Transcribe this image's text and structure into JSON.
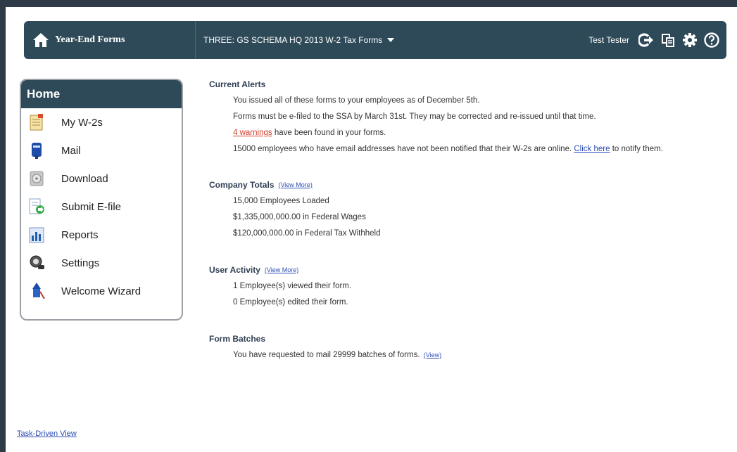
{
  "header": {
    "brand_title": "Year-End Forms",
    "schema_selector": "THREE: GS SCHEMA HQ 2013 W-2 Tax Forms",
    "user_name": "Test Tester",
    "colors": {
      "bar": "#2e4a58",
      "text": "#ffffff"
    },
    "icons": [
      "home-icon",
      "logout-icon",
      "copy-icon",
      "gear-icon",
      "help-icon"
    ]
  },
  "sidebar": {
    "title": "Home",
    "items": [
      {
        "label": "My W-2s",
        "icon": "w2-document-icon"
      },
      {
        "label": "Mail",
        "icon": "mailbox-icon"
      },
      {
        "label": "Download",
        "icon": "disc-download-icon"
      },
      {
        "label": "Submit E-file",
        "icon": "submit-efile-icon"
      },
      {
        "label": "Reports",
        "icon": "reports-chart-icon"
      },
      {
        "label": "Settings",
        "icon": "settings-icon"
      },
      {
        "label": "Welcome Wizard",
        "icon": "wizard-icon"
      }
    ]
  },
  "alerts": {
    "heading": "Current Alerts",
    "line1": "You issued all of these forms to your employees as of December 5th.",
    "line2": "Forms must be e-filed to the SSA by March 31st. They may be corrected and re-issued until that time.",
    "warnings_link": "4 warnings",
    "warnings_rest": " have been found in your forms.",
    "line4_pre": "15000 employees who have email addresses have not been notified that their W-2s are online. ",
    "line4_link": "Click here",
    "line4_post": " to notify them."
  },
  "company_totals": {
    "heading": "Company Totals",
    "view_more": "(View More)",
    "items": [
      "15,000 Employees Loaded",
      "$1,335,000,000.00 in Federal Wages",
      "$120,000,000.00 in Federal Tax Withheld"
    ]
  },
  "user_activity": {
    "heading": "User Activity",
    "view_more": "(View More)",
    "items": [
      "1 Employee(s) viewed their form.",
      "0 Employee(s) edited their form."
    ]
  },
  "form_batches": {
    "heading": "Form Batches",
    "text": "You have requested to mail 29999 batches of forms.",
    "view_link": "(View)"
  },
  "footer": {
    "task_view_link": "Task-Driven View"
  }
}
